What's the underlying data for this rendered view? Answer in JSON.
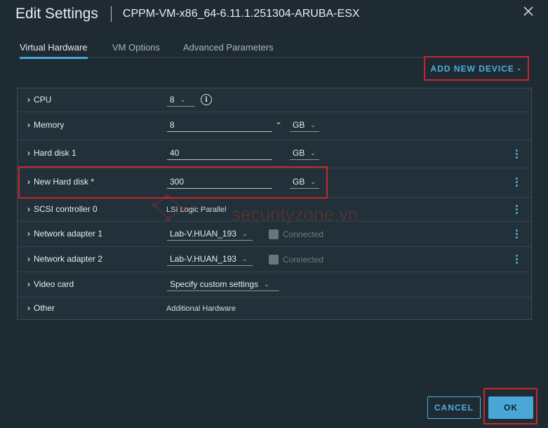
{
  "dialog": {
    "title": "Edit Settings",
    "subtitle": "CPPM-VM-x86_64-6.11.1.251304-ARUBA-ESX"
  },
  "tabs": [
    {
      "label": "Virtual Hardware"
    },
    {
      "label": "VM Options"
    },
    {
      "label": "Advanced Parameters"
    }
  ],
  "add_device": {
    "label": "ADD NEW DEVICE"
  },
  "hardware": {
    "cpu": {
      "label": "CPU",
      "value": "8"
    },
    "memory": {
      "label": "Memory",
      "value": "8",
      "unit": "GB"
    },
    "hard_disk_1": {
      "label": "Hard disk 1",
      "value": "40",
      "unit": "GB"
    },
    "new_hard_disk": {
      "label": "New Hard disk *",
      "value": "300",
      "unit": "GB"
    },
    "scsi": {
      "label": "SCSI controller 0",
      "value": "LSI Logic Parallel"
    },
    "net1": {
      "label": "Network adapter 1",
      "value": "Lab-V.HUAN_193",
      "connected_label": "Connected"
    },
    "net2": {
      "label": "Network adapter 2",
      "value": "Lab-V.HUAN_193",
      "connected_label": "Connected"
    },
    "video": {
      "label": "Video card",
      "value": "Specify custom settings"
    },
    "other": {
      "label": "Other",
      "value": "Additional Hardware"
    }
  },
  "footer": {
    "cancel_label": "CANCEL",
    "ok_label": "OK"
  },
  "watermark": {
    "text": "securityzone.vn"
  },
  "colors": {
    "background": "#1f2b33",
    "accent": "#4bb0e3",
    "highlight": "#c8262b",
    "ok_button": "#49a6d7"
  }
}
